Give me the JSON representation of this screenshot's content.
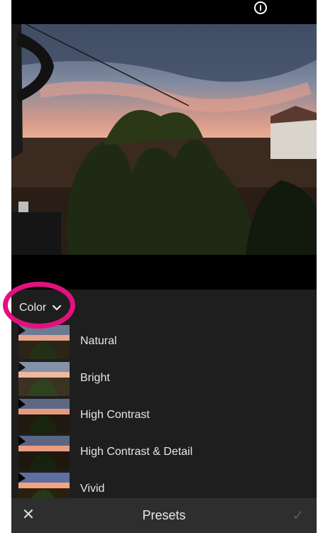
{
  "header": {
    "help_icon": "info-icon"
  },
  "photo": {
    "description_icon": "sunset-garden-photo"
  },
  "category": {
    "label": "Color",
    "icon": "chevron-down-icon"
  },
  "presets": [
    {
      "label": "Natural"
    },
    {
      "label": "Bright"
    },
    {
      "label": "High Contrast"
    },
    {
      "label": "High Contrast & Detail"
    },
    {
      "label": "Vivid"
    }
  ],
  "bottom_bar": {
    "close_icon": "close-icon",
    "title": "Presets",
    "confirm_icon": "check-icon"
  },
  "colors": {
    "panel_bg": "#1e1e1e",
    "bar_bg": "#2e2e2e",
    "highlight": "#e3117d"
  }
}
